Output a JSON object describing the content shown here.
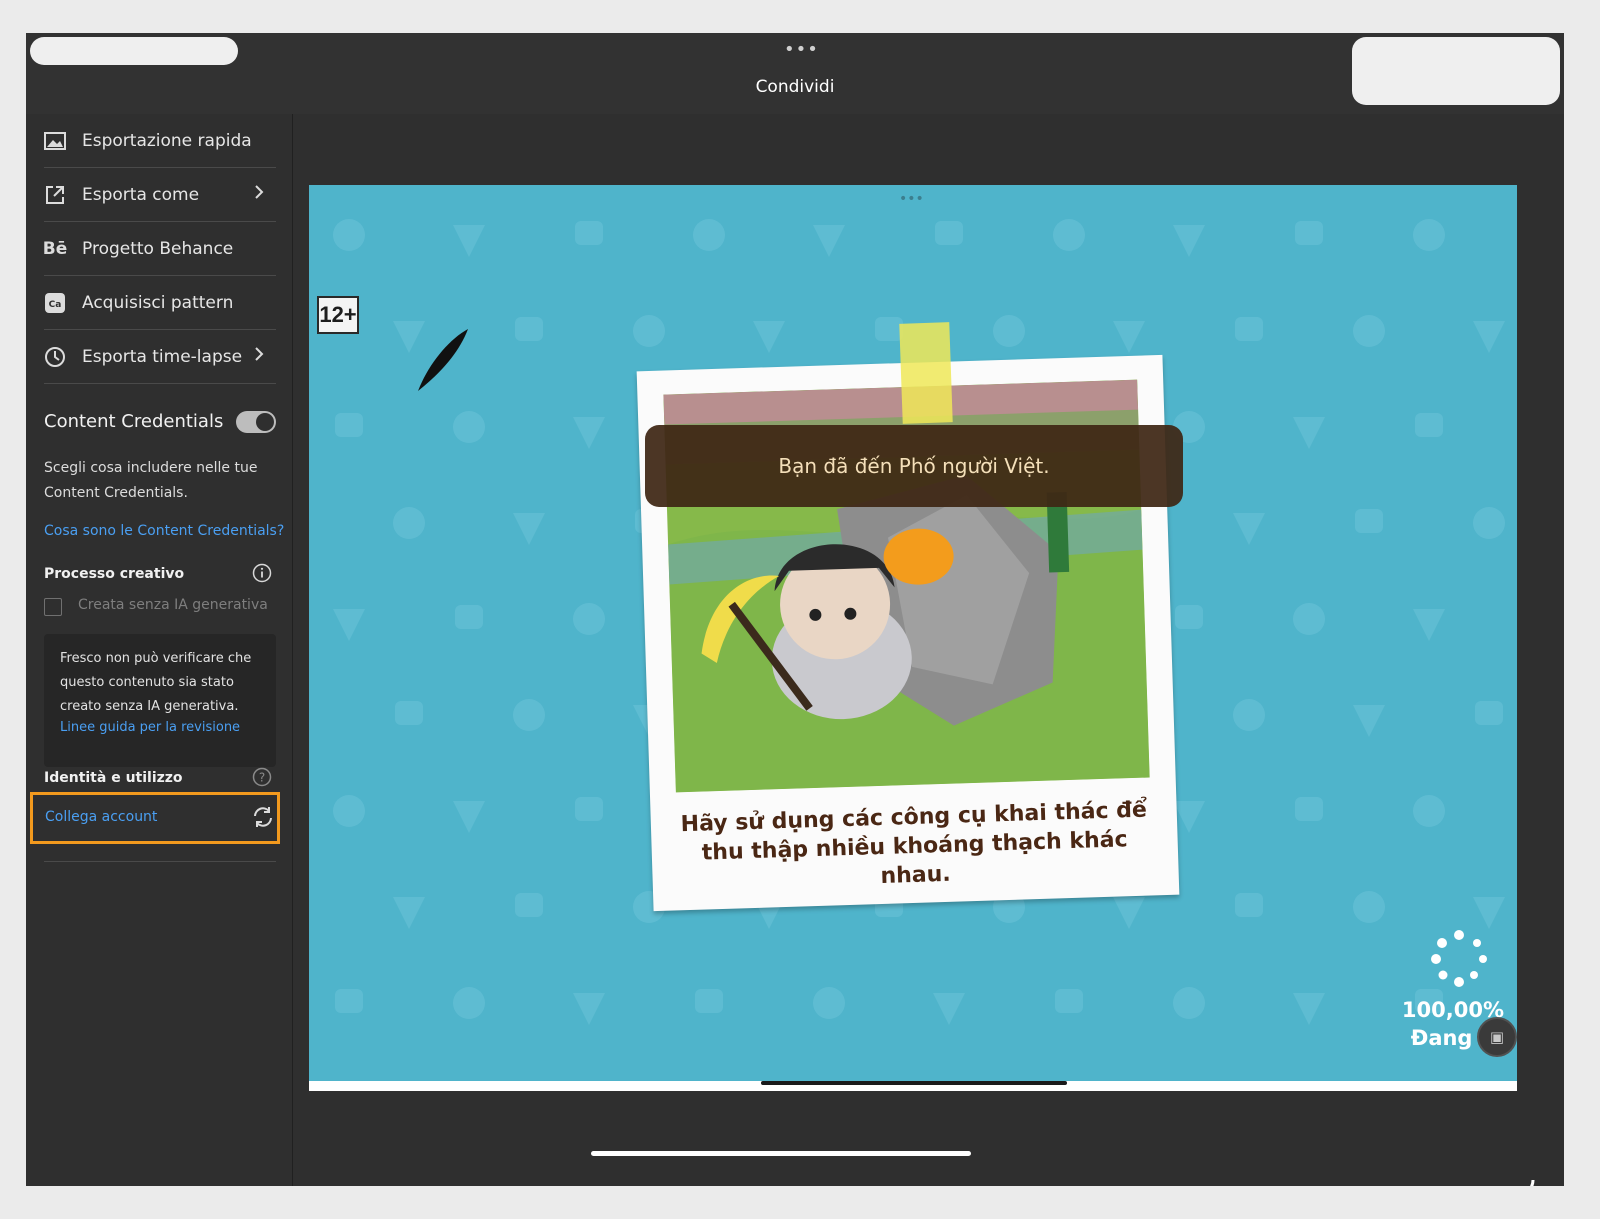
{
  "window": {
    "title": "Condividi"
  },
  "menu": [
    {
      "label": "Esportazione rapida",
      "icon": "image-icon",
      "has_arrow": false
    },
    {
      "label": "Esporta come",
      "icon": "export-icon",
      "has_arrow": true
    },
    {
      "label": "Progetto Behance",
      "icon": "behance-icon",
      "has_arrow": false
    },
    {
      "label": "Acquisisci pattern",
      "icon": "capture-icon",
      "has_arrow": false
    },
    {
      "label": "Esporta time-lapse",
      "icon": "clock-icon",
      "has_arrow": true
    }
  ],
  "content_credentials": {
    "title": "Content Credentials",
    "enabled": true,
    "description": "Scegli cosa includere nelle tue Content Credentials.",
    "link": "Cosa sono le Content Credentials?",
    "creative_process": {
      "label": "Processo creativo",
      "checkbox_label": "Creata senza IA generativa",
      "checked": false,
      "notice": "Fresco non può verificare che questo contenuto sia stato creato senza IA generativa.",
      "notice_link": "Linee guida per la revisione"
    },
    "identity": {
      "label": "Identità e utilizzo",
      "connect_label": "Collega account"
    }
  },
  "artwork": {
    "rating": "12+",
    "banner": "Bạn đã đến Phố người Việt.",
    "caption_line1": "Hãy sử dụng các công cụ khai thác để",
    "caption_line2": "thu thập nhiều khoáng thạch khác nhau.",
    "progress_value": "100,00%",
    "progress_label": "Đang tả"
  },
  "colors": {
    "accent_link": "#4a9ff2",
    "highlight_box": "#f39a1e",
    "artwork_bg": "#4fb4cb"
  }
}
